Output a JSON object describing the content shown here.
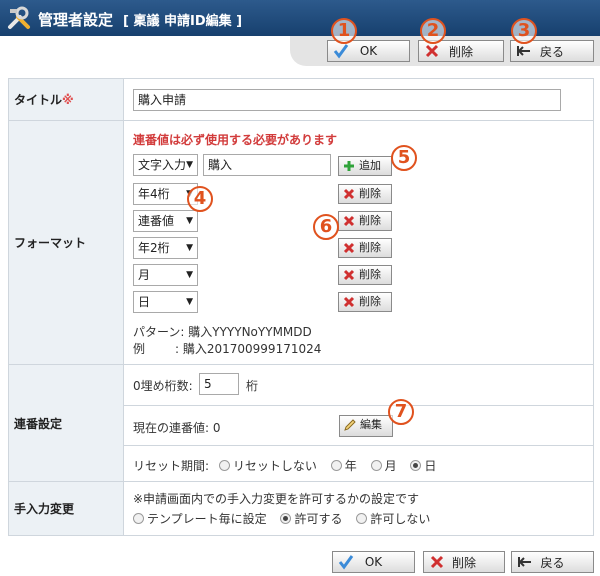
{
  "header": {
    "title": "管理者設定",
    "subtitle": "[ 稟議 申請ID編集 ]"
  },
  "toolbar": {
    "ok_label": "OK",
    "delete_label": "削除",
    "back_label": "戻る"
  },
  "markers": [
    "1",
    "2",
    "3",
    "4",
    "5",
    "6",
    "7"
  ],
  "form": {
    "title_label": "タイトル",
    "required_mark": "※",
    "title_value": "購入申請",
    "format_label": "フォーマット",
    "format_note": "連番値は必ず使用する必要があります",
    "format_rows": [
      {
        "select": "文字入力",
        "text": "購入",
        "button": "追加"
      },
      {
        "select": "年4桁",
        "button": "削除"
      },
      {
        "select": "連番値",
        "button": "削除"
      },
      {
        "select": "年2桁",
        "button": "削除"
      },
      {
        "select": "月",
        "button": "削除"
      },
      {
        "select": "日",
        "button": "削除"
      }
    ],
    "pattern_label": "パターン",
    "pattern_value": ": 購入YYYYNoYYMMDD",
    "example_label": "例",
    "example_value": ": 購入201700999171024",
    "serial_label": "連番設定",
    "zero_pad_label": "0埋め桁数:",
    "zero_pad_value": "5",
    "zero_pad_unit": "桁",
    "current_label": "現在の連番値: 0",
    "edit_button": "編集",
    "reset_label": "リセット期間:",
    "reset_options": [
      "リセットしない",
      "年",
      "月",
      "日"
    ],
    "reset_selected": "日",
    "manual_label": "手入力変更",
    "manual_note": "※申請画面内での手入力変更を許可するかの設定です",
    "manual_options": [
      "テンプレート毎に設定",
      "許可する",
      "許可しない"
    ],
    "manual_selected": "許可する"
  },
  "colors": {
    "header_bg": "#17406e",
    "marker": "#e0521e",
    "label_bg": "#ecf1f5",
    "note_red": "#d23c3c"
  }
}
